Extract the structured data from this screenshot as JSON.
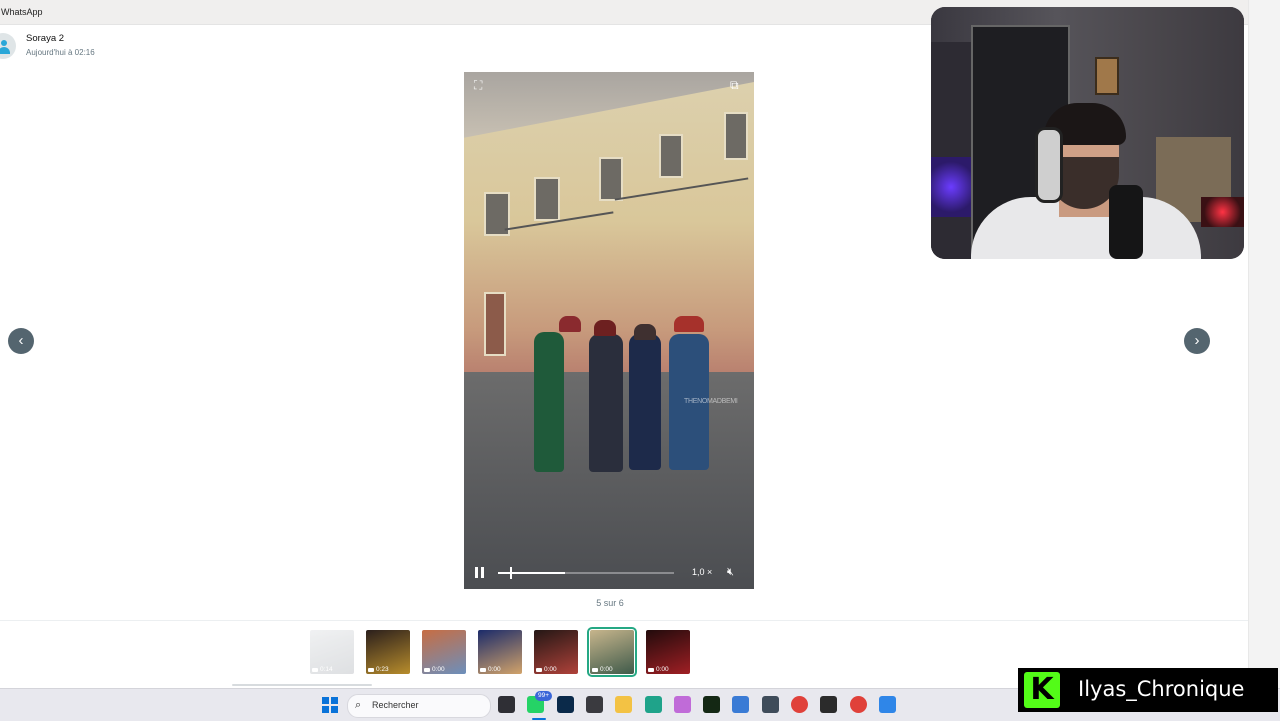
{
  "app": {
    "title": "WhatsApp"
  },
  "header": {
    "sender_name": "Soraya 2",
    "timestamp": "Aujourd'hui à 02:16"
  },
  "viewer": {
    "watermark": "THENOMADBEMI",
    "speed": "1,0 ×",
    "playback_progress": 0.38,
    "position_counter": "5 sur 6",
    "icons": {
      "expand": "expand-icon",
      "popout": "popout-icon",
      "pause": "pause-icon",
      "mute": "mute-icon"
    }
  },
  "nav": {
    "prev": "‹",
    "next": "›"
  },
  "thumbnails": [
    {
      "duration": "0:14",
      "colors": [
        "#e6e8ea",
        "#c9ccd0"
      ]
    },
    {
      "duration": "0:23",
      "colors": [
        "#2b1f1c",
        "#b88d2c"
      ]
    },
    {
      "duration": "0:00",
      "colors": [
        "#c76d43",
        "#6c8fbc"
      ]
    },
    {
      "duration": "0:00",
      "colors": [
        "#1b2b6a",
        "#d2a36a"
      ]
    },
    {
      "duration": "0:00",
      "colors": [
        "#241715",
        "#b0423a"
      ]
    },
    {
      "duration": "0:00",
      "colors": [
        "#c7b58c",
        "#3f5a4a"
      ],
      "active": true
    },
    {
      "duration": "0:00",
      "colors": [
        "#220b0c",
        "#a01f24"
      ]
    }
  ],
  "taskbar": {
    "search_placeholder": "Rechercher",
    "whatsapp_badge": "99+",
    "apps": [
      {
        "name": "file-explorer-icon",
        "color": "#2f2f35"
      },
      {
        "name": "whatsapp-icon",
        "color": "#25d366"
      },
      {
        "name": "photoshop-icon",
        "color": "#0b2a4a"
      },
      {
        "name": "obs-icon",
        "color": "#3a3a3f"
      },
      {
        "name": "folder-icon",
        "color": "#f3c244"
      },
      {
        "name": "edge-icon",
        "color": "#1fa38a"
      },
      {
        "name": "copilot-icon",
        "color": "#c06bd8"
      },
      {
        "name": "capcut-icon",
        "color": "#142814"
      },
      {
        "name": "snipping-tool-icon",
        "color": "#3a7bd5"
      },
      {
        "name": "app-icon",
        "color": "#3f4c5a"
      },
      {
        "name": "chrome-icon",
        "color": "#e0413a"
      },
      {
        "name": "creative-cloud-icon",
        "color": "#2b2b2b"
      },
      {
        "name": "chrome-alt-icon",
        "color": "#e0413a"
      },
      {
        "name": "photos-icon",
        "color": "#2f86e8"
      }
    ]
  },
  "overlay": {
    "streamer_name": "Ilyas_Chronique",
    "logo_letter": "K",
    "logo_color": "#53fc18"
  }
}
